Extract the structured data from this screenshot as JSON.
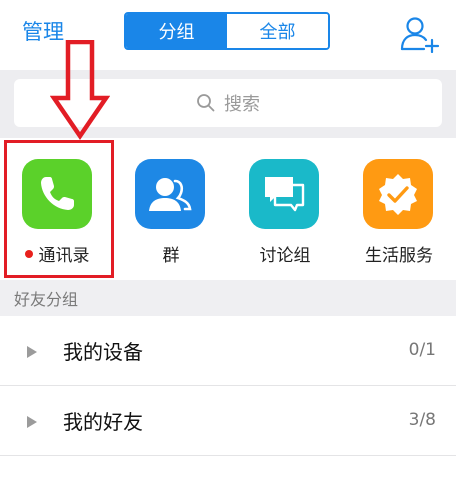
{
  "header": {
    "manage_label": "管理",
    "tabs": [
      {
        "label": "分组",
        "active": true
      },
      {
        "label": "全部",
        "active": false
      }
    ],
    "add_friend_icon": "add-contact-icon"
  },
  "search": {
    "placeholder": "搜索",
    "icon": "search-icon"
  },
  "apps": [
    {
      "label": "通讯录",
      "icon": "phone-icon",
      "color": "#5bd12a",
      "has_red_dot": true
    },
    {
      "label": "群",
      "icon": "group-icon",
      "color": "#1e88e5"
    },
    {
      "label": "讨论组",
      "icon": "chat-bubbles-icon",
      "color": "#1ab9c9"
    },
    {
      "label": "生活服务",
      "icon": "service-badge-icon",
      "color": "#ff9a12"
    }
  ],
  "friends_section": {
    "title": "好友分组",
    "groups": [
      {
        "name": "我的设备",
        "count": "0/1"
      },
      {
        "name": "我的好友",
        "count": "3/8"
      }
    ]
  },
  "colors": {
    "accent": "#1a86e8",
    "annotation_red": "#e21d25",
    "section_bg": "#efeff2"
  }
}
